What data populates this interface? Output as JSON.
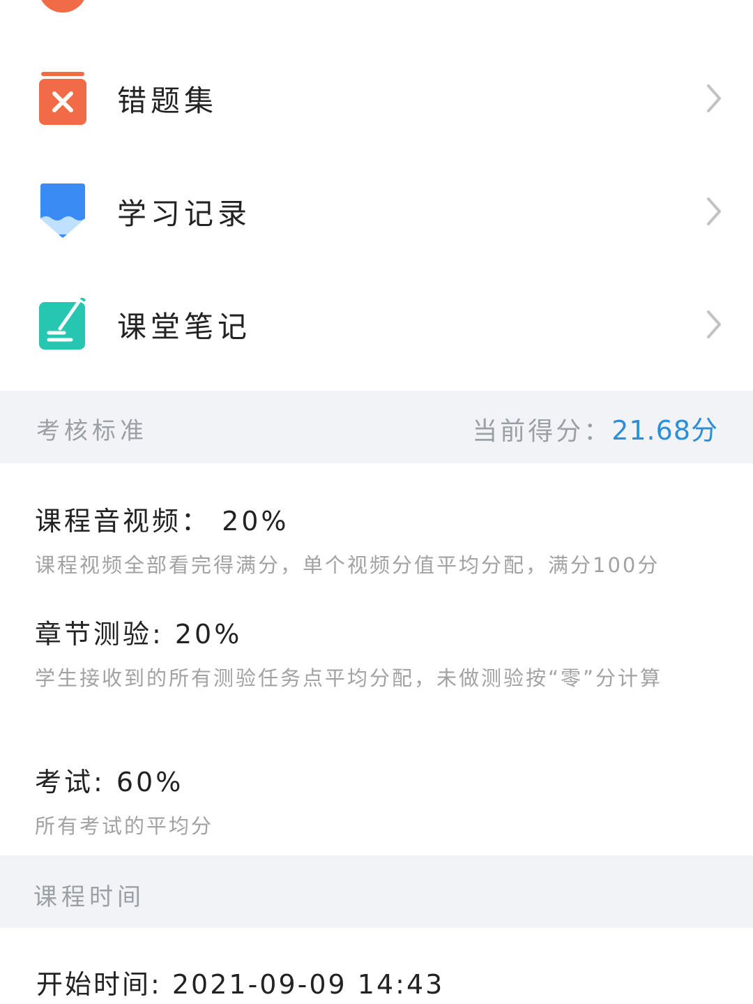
{
  "menu": {
    "items": [
      {
        "label": "错题集",
        "icon": "wrong-answers-icon",
        "color": "#f26b47"
      },
      {
        "label": "学习记录",
        "icon": "pencil-icon",
        "color": "#3b8bf5"
      },
      {
        "label": "课堂笔记",
        "icon": "note-edit-icon",
        "color": "#26c6b0"
      }
    ]
  },
  "assessment": {
    "header_title": "考核标准",
    "score_label": "当前得分：",
    "score_value": "21.68分",
    "score_color": "#2a8fd8",
    "criteria": [
      {
        "title": "课程音视频：  20%",
        "desc": "课程视频全部看完得满分，单个视频分值平均分配，满分100分"
      },
      {
        "title": "章节测验: 20%",
        "desc": "学生接收到的所有测验任务点平均分配，未做测验按“零”分计算"
      },
      {
        "title": "考试: 60%",
        "desc": "所有考试的平均分"
      }
    ]
  },
  "course_time": {
    "header_title": "课程时间",
    "start_time": "开始时间: 2021-09-09  14:43"
  }
}
